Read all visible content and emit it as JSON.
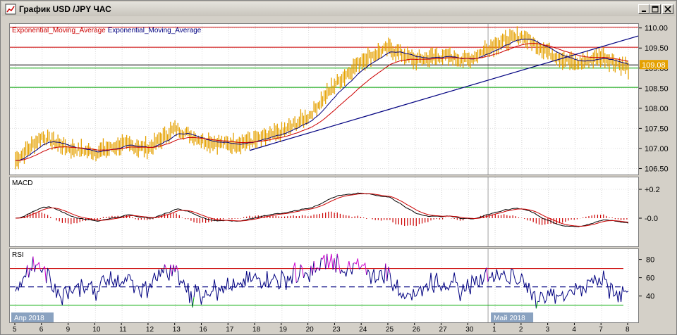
{
  "window": {
    "title": "График USD /JPY  ЧАС",
    "buttons": [
      "minimize",
      "maximize",
      "close"
    ]
  },
  "indicator_labels": {
    "ema1": "Exponential_Moving_Average",
    "ema2": "Exponential_Moving_Average",
    "macd": "MACD",
    "rsi": "RSI"
  },
  "price_axis": {
    "ticks": [
      "110.00",
      "109.50",
      "109.00",
      "108.50",
      "108.00",
      "107.50",
      "107.00",
      "106.50"
    ],
    "current_price": "109.08"
  },
  "macd_axis": {
    "ticks": [
      "+0.2",
      "-0.0"
    ]
  },
  "rsi_axis": {
    "ticks": [
      "80",
      "60",
      "40"
    ]
  },
  "x_axis": {
    "month_labels": [
      "Апр 2018",
      "Май 2018"
    ],
    "day_labels": [
      "5",
      "6",
      "9",
      "10",
      "11",
      "12",
      "13",
      "16",
      "17",
      "18",
      "19",
      "20",
      "23",
      "24",
      "25",
      "26",
      "27",
      "30",
      "1",
      "2",
      "3",
      "4",
      "7",
      "8"
    ]
  },
  "colors": {
    "price_bars": "#e5a100",
    "ema_fast": "#000080",
    "ema_slow": "#cc0000",
    "trendline": "#000080",
    "resistance_line": "#cc0000",
    "support_line": "#00a000",
    "current_price_badge": "#e5a100",
    "rsi_line": "#000080",
    "rsi_overbought": "#cc00cc",
    "rsi_oversold": "#00aa00",
    "macd_hist": "#cc0000"
  },
  "chart_data": {
    "type": "line",
    "symbol": "USD /JPY",
    "timeframe": "ЧАС",
    "x": [
      "5",
      "6",
      "9",
      "10",
      "11",
      "12",
      "13",
      "16",
      "17",
      "18",
      "19",
      "20",
      "23",
      "24",
      "25",
      "26",
      "27",
      "30",
      "1",
      "2",
      "3",
      "4",
      "7",
      "8"
    ],
    "series": [
      {
        "values": [
          106.7,
          107.3,
          107.0,
          106.9,
          107.1,
          107.0,
          107.5,
          107.2,
          107.1,
          107.2,
          107.4,
          107.8,
          108.6,
          109.2,
          109.5,
          109.2,
          109.3,
          109.2,
          109.6,
          109.8,
          109.4,
          109.1,
          109.3,
          109.0
        ]
      }
    ],
    "ylim": [
      106.35,
      110.1
    ],
    "horizontal_levels": [
      110.02,
      109.52,
      109.08,
      109.0,
      108.52
    ],
    "grid": true
  }
}
